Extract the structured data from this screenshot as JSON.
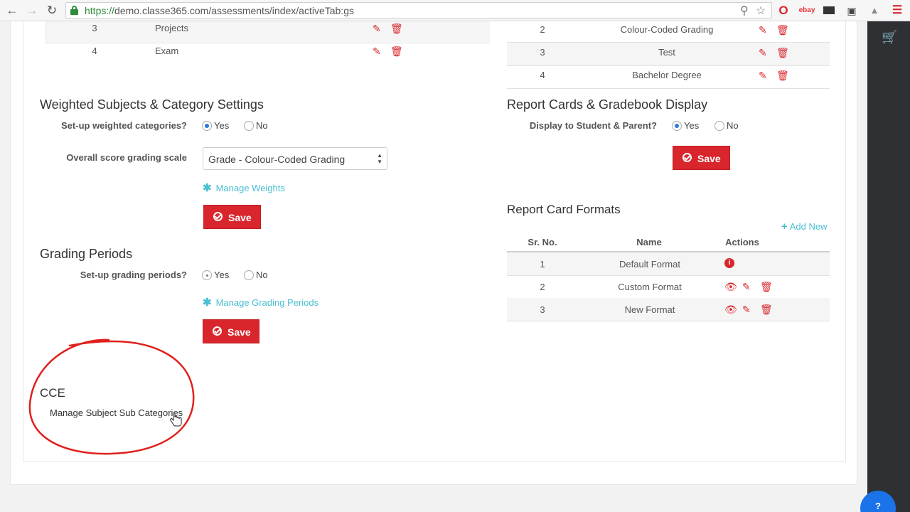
{
  "browser": {
    "url_scheme": "https://",
    "url_rest": "demo.classe365.com/assessments/index/activeTab:gs",
    "ext_ebay": "ebay"
  },
  "left_table": {
    "rows": [
      {
        "num": "3",
        "name": "Projects"
      },
      {
        "num": "4",
        "name": "Exam"
      }
    ]
  },
  "right_table": {
    "rows": [
      {
        "num": "2",
        "name": "Colour-Coded Grading"
      },
      {
        "num": "3",
        "name": "Test"
      },
      {
        "num": "4",
        "name": "Bachelor Degree"
      }
    ]
  },
  "weighted": {
    "title": "Weighted Subjects & Category Settings",
    "setup_label": "Set-up weighted categories?",
    "yes": "Yes",
    "no": "No",
    "scale_label": "Overall score grading scale",
    "scale_value": "Grade - Colour-Coded Grading",
    "manage_link": "Manage Weights",
    "save": "Save"
  },
  "grading_periods": {
    "title": "Grading Periods",
    "setup_label": "Set-up grading periods?",
    "yes": "Yes",
    "no": "No",
    "manage_link": "Manage Grading Periods",
    "save": "Save"
  },
  "cce": {
    "title": "CCE",
    "link": "Manage Subject Sub Categories"
  },
  "report_display": {
    "title": "Report Cards & Gradebook Display",
    "label": "Display to Student & Parent?",
    "yes": "Yes",
    "no": "No",
    "save": "Save"
  },
  "report_formats": {
    "title": "Report Card Formats",
    "add_new": "Add New",
    "headers": {
      "sr": "Sr. No.",
      "name": "Name",
      "actions": "Actions"
    },
    "rows": [
      {
        "num": "1",
        "name": "Default Format"
      },
      {
        "num": "2",
        "name": "Custom Format"
      },
      {
        "num": "3",
        "name": "New Format"
      }
    ]
  },
  "help": {
    "label": "?"
  },
  "colors": {
    "accent_red": "#d9262c",
    "link_cyan": "#4bbfd2",
    "radio_blue": "#2b7bd9"
  }
}
